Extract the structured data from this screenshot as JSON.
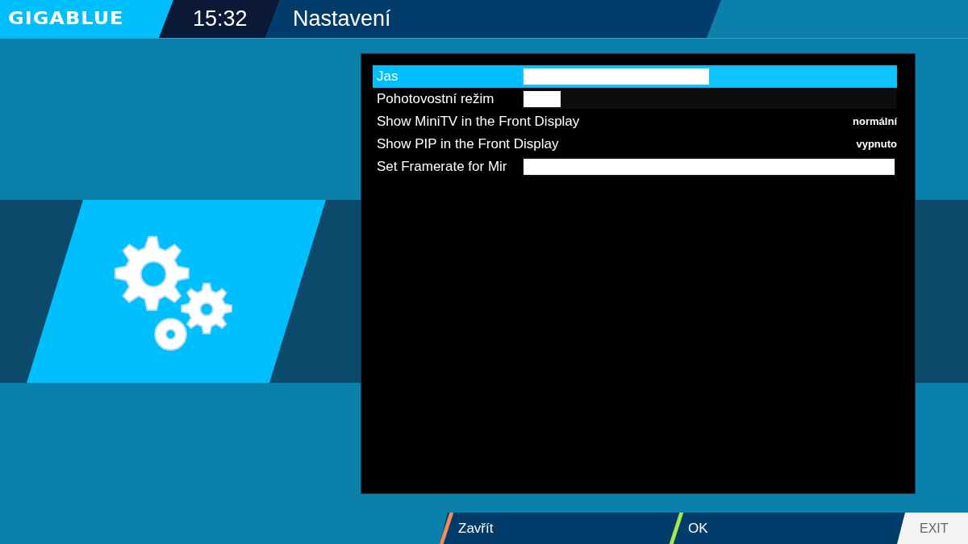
{
  "header": {
    "logo": "GIGABLUE",
    "clock": "15:32",
    "title": "Nastavení"
  },
  "settings": [
    {
      "kind": "slider",
      "label": "Jas",
      "level": 0.5,
      "selected": true
    },
    {
      "kind": "slider",
      "label": "Pohotovostní režim",
      "level": 0.1,
      "selected": false
    },
    {
      "kind": "choice",
      "label": "Show MiniTV in the Front Display",
      "value": "normální",
      "selected": false
    },
    {
      "kind": "choice",
      "label": "Show PIP in the Front Display",
      "value": "vypnuto",
      "selected": false
    },
    {
      "kind": "slider",
      "label": "Set Framerate for Mir",
      "level": 1.0,
      "selected": false
    }
  ],
  "buttons": [
    {
      "label": "Zavřít",
      "color": "#f58a5c"
    },
    {
      "label": "OK",
      "color": "#a6e84a"
    }
  ],
  "exit_label": "EXIT"
}
